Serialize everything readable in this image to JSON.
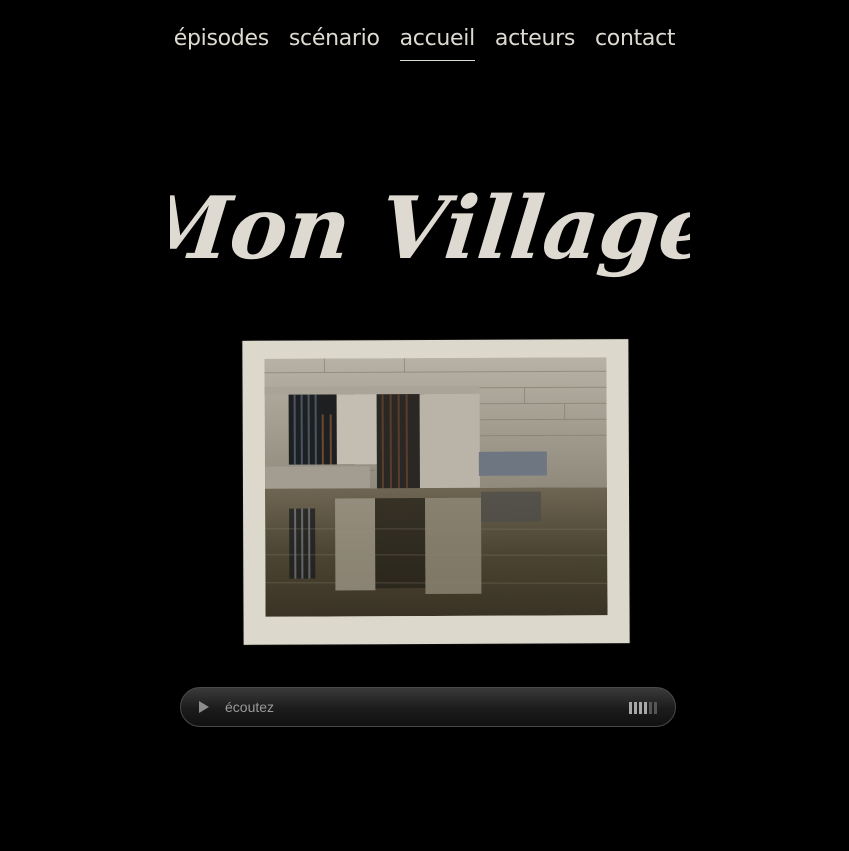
{
  "nav": {
    "items": [
      {
        "label": "épisodes",
        "active": false
      },
      {
        "label": "scénario",
        "active": false
      },
      {
        "label": "accueil",
        "active": true
      },
      {
        "label": "acteurs",
        "active": false
      },
      {
        "label": "contact",
        "active": false
      }
    ]
  },
  "title": "Mon Village",
  "player": {
    "label": "écoutez",
    "volume_level": 0.6
  },
  "colors": {
    "background": "#000000",
    "text": "#dedad1",
    "frame": "#dcd8cc"
  }
}
